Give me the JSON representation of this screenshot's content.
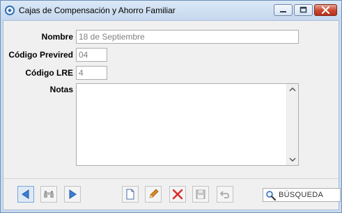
{
  "window": {
    "title": "Cajas de Compensación y Ahorro Familiar"
  },
  "form": {
    "nombre_label": "Nombre",
    "nombre_value": "18 de Septiembre",
    "codigo_previred_label": "Código Previred",
    "codigo_previred_value": "04",
    "codigo_lre_label": "Código LRE",
    "codigo_lre_value": "4",
    "notas_label": "Notas",
    "notas_value": ""
  },
  "toolbar": {
    "search_placeholder": "BÚSQUEDA"
  },
  "colors": {
    "accent": "#3a7fd5",
    "delete": "#d92b2b",
    "edit": "#e08a1e"
  }
}
